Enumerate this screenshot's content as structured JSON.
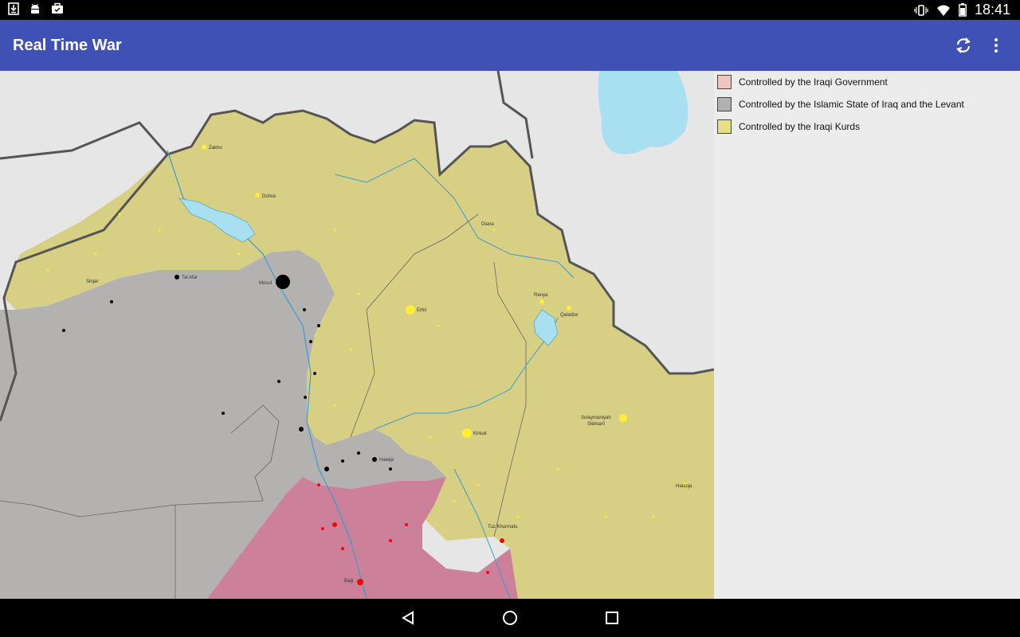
{
  "status_bar": {
    "time": "18:41",
    "left_icons": [
      "download-icon",
      "android-icon",
      "briefcase-icon"
    ],
    "right_icons": [
      "vibrate-icon",
      "wifi-icon",
      "battery-icon"
    ]
  },
  "app_bar": {
    "title": "Real Time War",
    "actions": [
      "refresh-icon",
      "overflow-menu-icon"
    ]
  },
  "legend": {
    "items": [
      {
        "label": "Controlled by the Iraqi Government",
        "color": "#f2c4bf"
      },
      {
        "label": "Controlled by the Islamic State of Iraq and the Levant",
        "color": "#b0b0b0"
      },
      {
        "label": "Controlled by the Iraqi Kurds",
        "color": "#e6df84"
      }
    ]
  },
  "map": {
    "colors": {
      "government": "#cc8099",
      "isil": "#b4b2b0",
      "kurds": "#d6cf84",
      "background": "#e6e6e6",
      "water": "#a8e0f2",
      "river": "#3b9bcf",
      "border": "#555555"
    },
    "labels": {
      "zakho": "Zakho",
      "dohuk": "Dohuk",
      "tal_afar": "Tal Afar",
      "mosul": "Mosul",
      "erbil": "Erbil",
      "diana": "Diana",
      "ranya": "Ranya",
      "qaladze": "Qaladze",
      "kirkuk": "Kirkuk",
      "hawija": "Hawija",
      "sulaymaniyah": "Sulaymaniyah",
      "sulaymaniyah_alt": "Slêmanî",
      "halabja": "Halabja",
      "tuz_khurmatu": "Tuz Khurmatu",
      "sinjar": "Sinjar",
      "baiji": "Baiji"
    }
  },
  "nav_bar": {
    "buttons": [
      "back-icon",
      "home-icon",
      "recents-icon"
    ]
  }
}
